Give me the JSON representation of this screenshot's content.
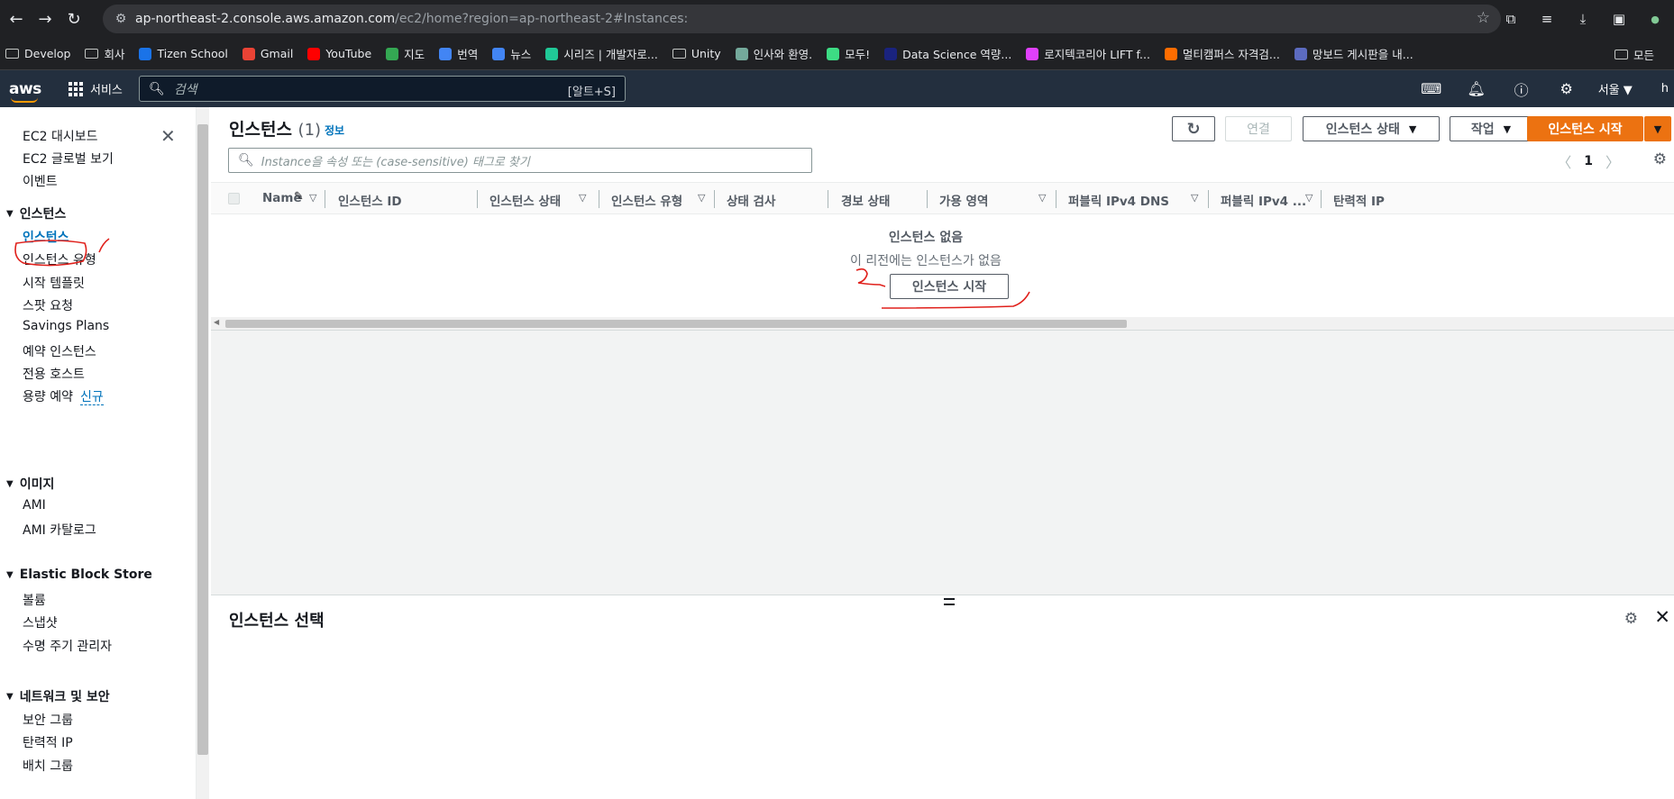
{
  "browser": {
    "url_host": "ap-northeast-2.console.aws.amazon.com",
    "url_path": "/ec2/home?region=ap-northeast-2#Instances:",
    "bookmarks": [
      {
        "label": "Develop",
        "kind": "folder"
      },
      {
        "label": "회사",
        "kind": "folder"
      },
      {
        "label": "Tizen School",
        "kind": "site",
        "color": "#1a73e8"
      },
      {
        "label": "Gmail",
        "kind": "site",
        "color": "#ea4335"
      },
      {
        "label": "YouTube",
        "kind": "site",
        "color": "#ff0000"
      },
      {
        "label": "지도",
        "kind": "site",
        "color": "#34a853"
      },
      {
        "label": "번역",
        "kind": "site",
        "color": "#4285f4"
      },
      {
        "label": "뉴스",
        "kind": "site",
        "color": "#4285f4"
      },
      {
        "label": "시리즈 | 개발자로...",
        "kind": "site",
        "color": "#20c997"
      },
      {
        "label": "Unity",
        "kind": "folder"
      },
      {
        "label": "인사와 환영.",
        "kind": "site",
        "color": "#74aa9c"
      },
      {
        "label": "모두!",
        "kind": "site",
        "color": "#3ddc84"
      },
      {
        "label": "Data Science 역량...",
        "kind": "site",
        "color": "#1a237e"
      },
      {
        "label": "로지텍코리아 LIFT f...",
        "kind": "site",
        "color": "#e040fb"
      },
      {
        "label": "멀티캠퍼스 자격검...",
        "kind": "site",
        "color": "#ff6d00"
      },
      {
        "label": "망보드 게시판을 내...",
        "kind": "site",
        "color": "#5c6bc0"
      }
    ],
    "bookmarks_right": "모든"
  },
  "aws_header": {
    "logo": "aws",
    "services": "서비스",
    "search_placeholder": "검색",
    "search_shortcut": "[알트+S]",
    "region": "서울",
    "user": "h"
  },
  "sidebar": {
    "top_items": [
      "EC2 대시보드",
      "EC2 글로벌 보기",
      "이벤트"
    ],
    "sections": [
      {
        "title": "인스턴스",
        "items": [
          "인스턴스",
          "인스턴스 유형",
          "시작 템플릿",
          "스팟 요청",
          "Savings Plans",
          "예약 인스턴스",
          "전용 호스트",
          "용량 예약"
        ]
      },
      {
        "title": "이미지",
        "items": [
          "AMI",
          "AMI 카탈로그"
        ]
      },
      {
        "title": "Elastic Block Store",
        "items": [
          "볼륨",
          "스냅샷",
          "수명 주기 관리자"
        ]
      },
      {
        "title": "네트워크 및 보안",
        "items": [
          "보안 그룹",
          "탄력적 IP",
          "배치 그룹"
        ]
      }
    ],
    "new_badge": "신규"
  },
  "main": {
    "title": "인스턴스",
    "count": "(1)",
    "info": "정보",
    "buttons": {
      "connect": "연결",
      "instance_state": "인스턴스 상태",
      "actions": "작업",
      "launch": "인스턴스 시작"
    },
    "filter_placeholder": "Instance을 속성 또는 (case-sensitive) 태그로 찾기",
    "page": "1",
    "columns": [
      "Name",
      "인스턴스 ID",
      "인스턴스 상태",
      "인스턴스 유형",
      "상태 검사",
      "경보 상태",
      "가용 영역",
      "퍼블릭 IPv4 DNS",
      "퍼블릭 IPv4 ...",
      "탄력적 IP"
    ],
    "empty_title": "인스턴스 없음",
    "empty_desc": "이 리전에는 인스턴스가 없음",
    "empty_button": "인스턴스 시작",
    "split_title": "인스턴스 선택"
  }
}
